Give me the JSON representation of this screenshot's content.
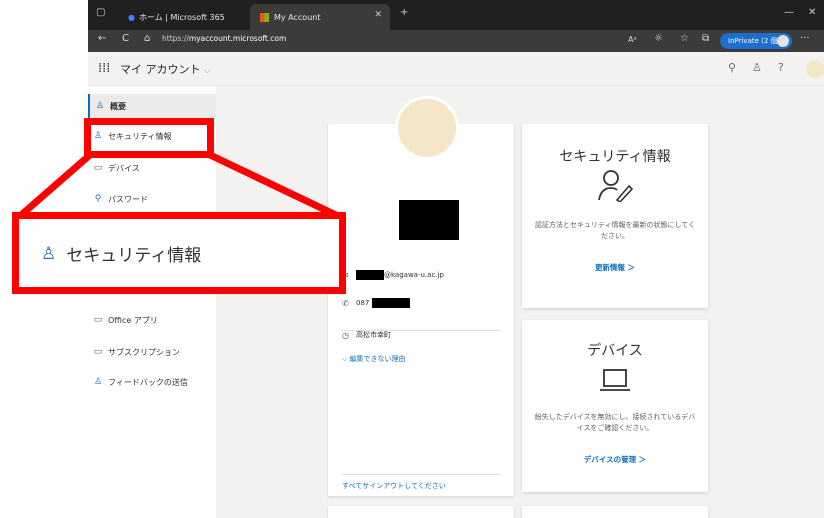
{
  "browser": {
    "tabs": [
      {
        "label": "ホーム | Microsoft 365"
      },
      {
        "label": "My Account"
      }
    ],
    "url_scheme": "https://",
    "url_host": "myaccount.microsoft.com",
    "inprivate_label": "InPrivate (2 個)",
    "new_tab": "+",
    "close_glyph": "✕",
    "minimize_glyph": "—",
    "back_glyph": "←",
    "refresh_glyph": "C",
    "more_glyph": "···"
  },
  "app": {
    "title": "マイ アカウント",
    "title_caret": "⌵",
    "help_glyph": "?"
  },
  "sidebar": {
    "items": [
      {
        "label": "概要"
      },
      {
        "label": "セキュリティ情報"
      },
      {
        "label": "デバイス"
      },
      {
        "label": "パスワード"
      },
      {
        "label": "Office アプリ"
      },
      {
        "label": "サブスクリプション"
      },
      {
        "label": "フィードバックの送信"
      }
    ]
  },
  "profile": {
    "email_suffix": "@kagawa-u.ac.jp",
    "phone_prefix": "087",
    "location": "高松市幸町",
    "uneditable_link": "編集できない理由",
    "signout_link": "すべてサインアウトしてください"
  },
  "security_card": {
    "title": "セキュリティ情報",
    "description": "認証方法とセキュリティ情報を最新の状態にしてください。",
    "link": "更新情報 ＞"
  },
  "devices_card": {
    "title": "デバイス",
    "description": "紛失したデバイスを無効にし、接続されているデバイスをご確認ください。",
    "link": "デバイスの管理 ＞"
  },
  "callout": {
    "label": "セキュリティ情報"
  },
  "colors": {
    "highlight": "#ff0000",
    "accent": "#0f6cbd"
  }
}
